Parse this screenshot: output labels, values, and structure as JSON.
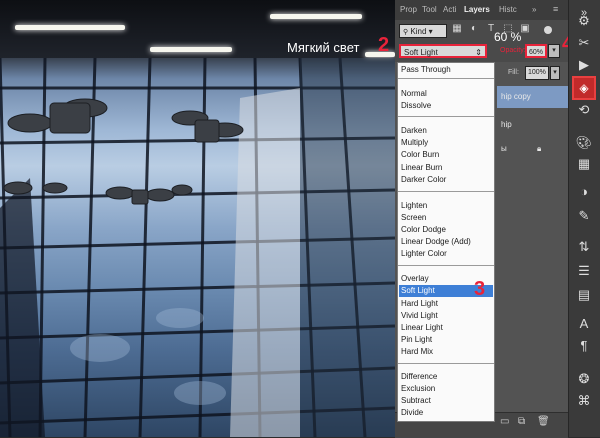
{
  "panel": {
    "tabs": [
      "Prop",
      "Tool",
      "Acti",
      "Layers",
      "Histc"
    ],
    "kind_label": "Kind",
    "blend_mode": "Soft Light",
    "opacity_label": "Opacity:",
    "opacity_value": "60%",
    "fill_label": "Fill:",
    "fill_value": "100%",
    "layers": [
      "hip copy",
      "hip",
      "ы"
    ]
  },
  "blend_menu": {
    "items": [
      "Pass Through",
      "Normal",
      "Dissolve",
      "Darken",
      "Multiply",
      "Color Burn",
      "Linear Burn",
      "Darker Color",
      "Lighten",
      "Screen",
      "Color Dodge",
      "Linear Dodge (Add)",
      "Lighter Color",
      "Overlay",
      "Soft Light",
      "Hard Light",
      "Vivid Light",
      "Linear Light",
      "Pin Light",
      "Hard Mix",
      "Difference",
      "Exclusion",
      "Subtract",
      "Divide"
    ],
    "selected": "Soft Light"
  },
  "annotations": {
    "label_ru": "Мягкий свет",
    "step2": "2",
    "step3": "3",
    "step4": "4",
    "opacity_note": "60 %"
  },
  "colors": {
    "accent_red": "#e8233a",
    "highlight_blue": "#3e7fd6",
    "panel_gray": "#535353"
  }
}
